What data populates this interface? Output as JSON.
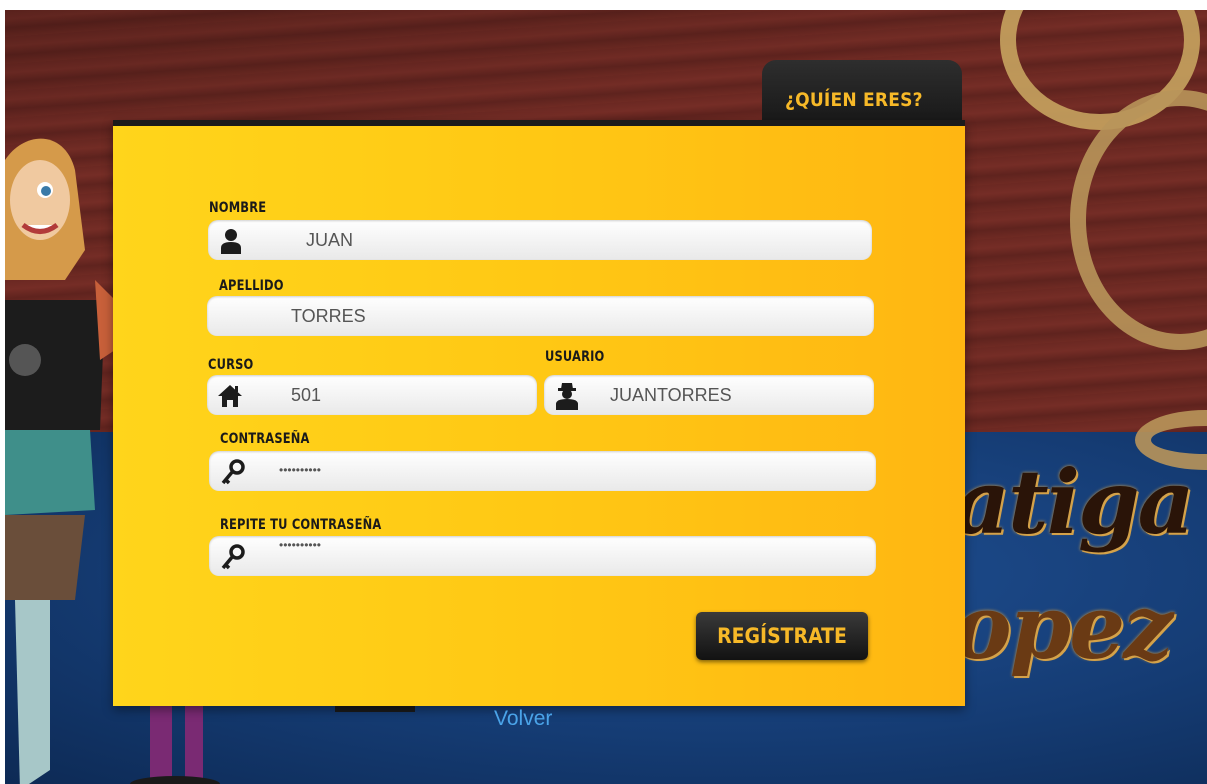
{
  "header": {
    "tab_title": "¿QUÍEN ERES?"
  },
  "form": {
    "nombre": {
      "label": "NOMBRE",
      "value": "JUAN"
    },
    "apellido": {
      "label": "APELLIDO",
      "value": "TORRES"
    },
    "curso": {
      "label": "CURSO",
      "value": "501"
    },
    "usuario": {
      "label": "USUARIO",
      "value": "JUANTORRES"
    },
    "contrasena": {
      "label": "CONTRASEÑA",
      "value": "••••••••••"
    },
    "repite": {
      "label": "REPITE TU CONTRASEÑA",
      "value": "••••••••••"
    },
    "submit_label": "REGÍSTRATE"
  },
  "footer": {
    "volver_label": "Volver"
  },
  "icons": {
    "nombre": "user-icon",
    "curso": "home-icon",
    "usuario": "spy-user-icon",
    "contrasena": "key-icon",
    "repite": "key-icon"
  },
  "colors": {
    "card": "#ffc814",
    "accent": "#f7b928",
    "button_bg": "#1b1b1b",
    "link": "#4aa3e8",
    "wood": "#6b2822",
    "blue": "#153c74"
  }
}
